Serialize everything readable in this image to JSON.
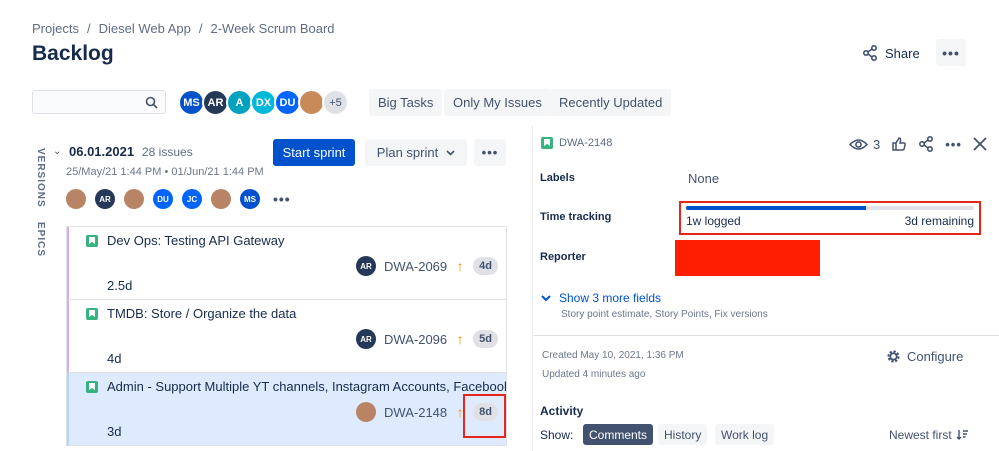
{
  "breadcrumb": [
    "Projects",
    "Diesel Web App",
    "2-Week Scrum Board"
  ],
  "page_title": "Backlog",
  "header": {
    "share_label": "Share"
  },
  "search": {
    "placeholder": ""
  },
  "avatars": [
    {
      "initials": "MS",
      "color": "#0052CC"
    },
    {
      "initials": "AR",
      "color": "#253858"
    },
    {
      "initials": "A",
      "color": "#00A3BF"
    },
    {
      "initials": "DX",
      "color": "#00B8D9"
    },
    {
      "initials": "DU",
      "color": "#0065FF"
    },
    {
      "initials": "",
      "color": "#c98a5a",
      "photo": true
    }
  ],
  "avatars_more": "+5",
  "filters": [
    "Big Tasks",
    "Only My Issues",
    "Recently Updated"
  ],
  "side_tabs": [
    "VERSIONS",
    "EPICS"
  ],
  "sprint": {
    "name": "06.01.2021",
    "issue_count": "28 issues",
    "dates": "25/May/21 1:44 PM • 01/Jun/21 1:44 PM",
    "start_label": "Start sprint",
    "plan_label": "Plan sprint",
    "assignees": [
      {
        "initials": "",
        "color": "#b98466",
        "photo": true
      },
      {
        "initials": "AR",
        "color": "#253858"
      },
      {
        "initials": "",
        "color": "#b98466",
        "photo": true
      },
      {
        "initials": "DU",
        "color": "#0065FF"
      },
      {
        "initials": "JC",
        "color": "#0065FF"
      },
      {
        "initials": "",
        "color": "#b98466",
        "photo": true
      },
      {
        "initials": "MS",
        "color": "#0052CC"
      }
    ]
  },
  "issues": [
    {
      "summary": "Dev Ops: Testing API Gateway",
      "assignee": "AR",
      "key": "DWA-2069",
      "estimate_badge": "4d",
      "time_spent": "2.5d",
      "selected": false
    },
    {
      "summary": "TMDB: Store / Organize the data",
      "assignee": "AR",
      "key": "DWA-2096",
      "estimate_badge": "5d",
      "time_spent": "4d",
      "selected": false
    },
    {
      "summary": "Admin - Support Multiple YT channels, Instagram Accounts, Facebook Accounts",
      "assignee": "",
      "key": "DWA-2148",
      "estimate_badge": "8d",
      "time_spent": "3d",
      "selected": true
    }
  ],
  "detail": {
    "key": "DWA-2148",
    "watchers": "3",
    "fields": {
      "labels_label": "Labels",
      "labels_value": "None",
      "time_tracking_label": "Time tracking",
      "logged": "1w logged",
      "remaining": "3d remaining",
      "progress_fraction": 0.625,
      "reporter_label": "Reporter"
    },
    "more_fields_label": "Show 3 more fields",
    "more_fields_sub": "Story point estimate, Story Points, Fix versions",
    "created": "Created May 10, 2021, 1:36 PM",
    "updated": "Updated 4 minutes ago",
    "configure_label": "Configure",
    "activity_title": "Activity",
    "show_label": "Show:",
    "activity_tabs": [
      "Comments",
      "History",
      "Work log"
    ],
    "sort_label": "Newest first"
  }
}
